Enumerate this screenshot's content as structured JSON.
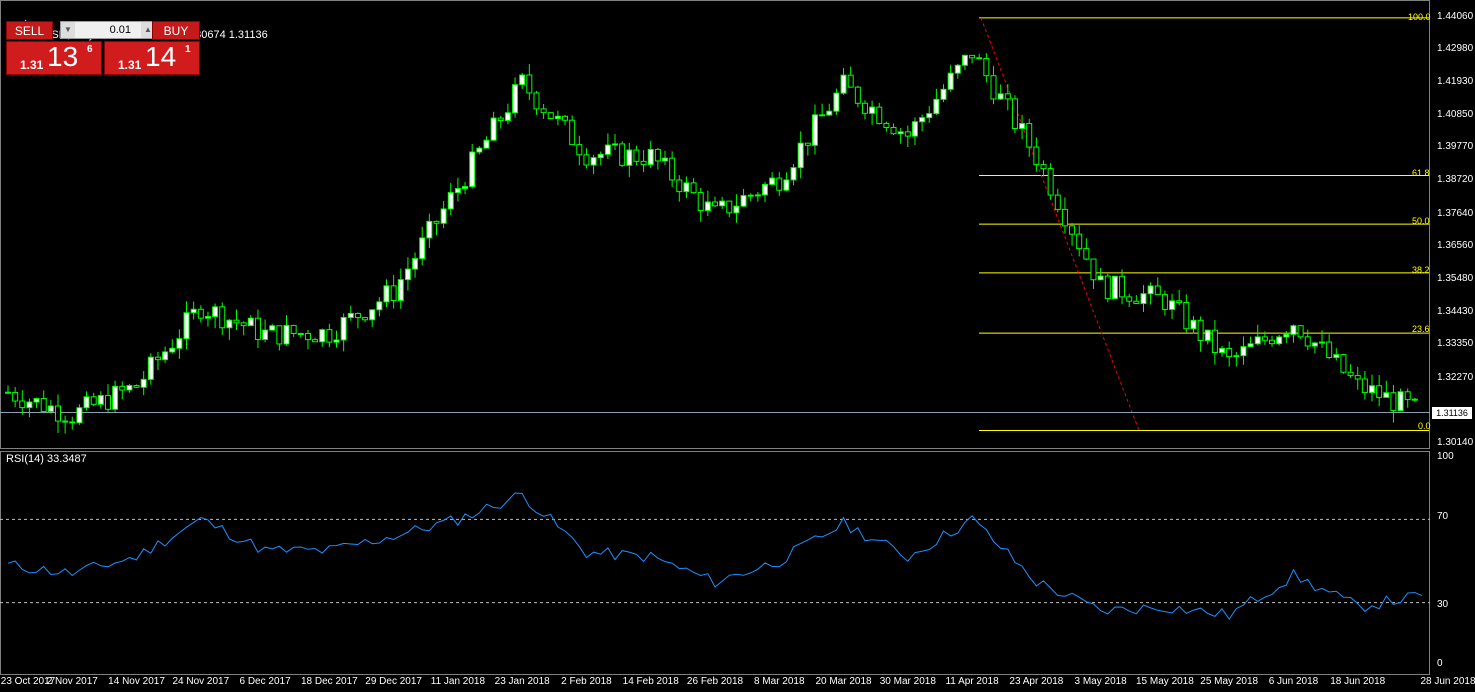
{
  "header": {
    "title": "GBPUSD,Daily  1.30759 1.31288 1.30674 1.31136"
  },
  "trade_panel": {
    "sell_label": "SELL",
    "buy_label": "BUY",
    "lot_value": "0.01",
    "sell_prefix": "1.31",
    "sell_big": "13",
    "sell_sup": "6",
    "buy_prefix": "1.31",
    "buy_big": "14",
    "buy_sup": "1"
  },
  "price_axis": {
    "labels": [
      "1.44060",
      "1.42980",
      "1.41930",
      "1.40850",
      "1.39770",
      "1.38720",
      "1.37640",
      "1.36560",
      "1.35480",
      "1.34430",
      "1.33350",
      "1.32270",
      "1.31136",
      "1.30140"
    ],
    "current_price": "1.31136"
  },
  "fibonacci": {
    "levels": [
      "100.0",
      "61.8",
      "50.0",
      "38.2",
      "23.6",
      "0.0"
    ]
  },
  "rsi": {
    "title": "RSI(14) 33.3487",
    "axis_labels": [
      "100",
      "70",
      "30",
      "0"
    ]
  },
  "dates": [
    "23 Oct 2017",
    "2 Nov 2017",
    "14 Nov 2017",
    "24 Nov 2017",
    "6 Dec 2017",
    "18 Dec 2017",
    "29 Dec 2017",
    "11 Jan 2018",
    "23 Jan 2018",
    "2 Feb 2018",
    "14 Feb 2018",
    "26 Feb 2018",
    "8 Mar 2018",
    "20 Mar 2018",
    "30 Mar 2018",
    "11 Apr 2018",
    "23 Apr 2018",
    "3 May 2018",
    "15 May 2018",
    "25 May 2018",
    "6 Jun 2018",
    "18 Jun 2018",
    "28 Jun 2018"
  ],
  "colors": {
    "background": "#000000",
    "bull_candle": "#ffffff",
    "bear_candle": "#000000",
    "wick": "#00ff00",
    "fib_line": "#ffff00",
    "rsi_line": "#1e90ff",
    "grid_dash": "#c0c0c0",
    "sell_button": "#c41a1a"
  },
  "chart_data": [
    {
      "type": "candlestick",
      "title": "GBPUSD,Daily",
      "ylim": [
        1.3014,
        1.4406
      ],
      "x": [
        "23 Oct 2017",
        "2 Nov 2017",
        "14 Nov 2017",
        "24 Nov 2017",
        "6 Dec 2017",
        "18 Dec 2017",
        "29 Dec 2017",
        "11 Jan 2018",
        "23 Jan 2018",
        "2 Feb 2018",
        "14 Feb 2018",
        "26 Feb 2018",
        "8 Mar 2018",
        "20 Mar 2018",
        "30 Mar 2018",
        "11 Apr 2018",
        "23 Apr 2018",
        "3 May 2018",
        "15 May 2018",
        "25 May 2018",
        "6 Jun 2018",
        "18 Jun 2018",
        "28 Jun 2018"
      ],
      "close": [
        1.318,
        1.3105,
        1.32,
        1.346,
        1.337,
        1.3375,
        1.351,
        1.385,
        1.419,
        1.396,
        1.395,
        1.376,
        1.388,
        1.418,
        1.402,
        1.429,
        1.395,
        1.353,
        1.348,
        1.328,
        1.341,
        1.32,
        1.3114
      ],
      "last": 1.31136
    },
    {
      "type": "line",
      "title": "RSI(14) 33.3487",
      "ylim": [
        0,
        100
      ],
      "x": [
        "23 Oct 2017",
        "2 Nov 2017",
        "14 Nov 2017",
        "24 Nov 2017",
        "6 Dec 2017",
        "18 Dec 2017",
        "29 Dec 2017",
        "11 Jan 2018",
        "23 Jan 2018",
        "2 Feb 2018",
        "14 Feb 2018",
        "26 Feb 2018",
        "8 Mar 2018",
        "20 Mar 2018",
        "30 Mar 2018",
        "11 Apr 2018",
        "23 Apr 2018",
        "3 May 2018",
        "15 May 2018",
        "25 May 2018",
        "6 Jun 2018",
        "18 Jun 2018",
        "28 Jun 2018"
      ],
      "values": [
        48,
        44,
        52,
        70,
        55,
        55,
        62,
        70,
        82,
        54,
        52,
        40,
        50,
        68,
        52,
        70,
        40,
        26,
        28,
        24,
        43,
        28,
        33.35
      ],
      "levels": [
        70,
        30
      ]
    }
  ]
}
